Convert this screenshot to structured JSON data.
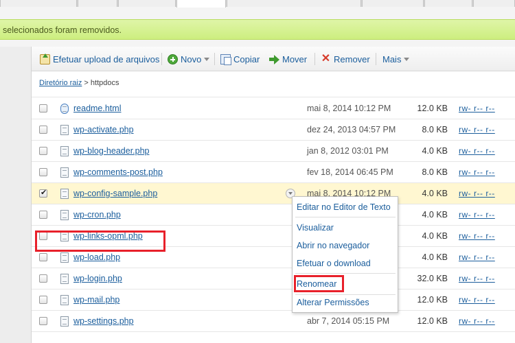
{
  "notice": {
    "text": "selecionados foram removidos."
  },
  "toolbar": {
    "upload_label": "Efetuar upload de arquivos",
    "new_label": "Novo",
    "copy_label": "Copiar",
    "move_label": "Mover",
    "remove_label": "Remover",
    "more_label": "Mais"
  },
  "breadcrumb": {
    "root": "Diretório raiz",
    "sep": ">",
    "current": "httpdocs"
  },
  "files": [
    {
      "name": "readme.html",
      "date": "mai 8, 2014 10:12 PM",
      "size": "12.0 KB",
      "perm": "rw- r-- r--",
      "type": "html",
      "checked": false
    },
    {
      "name": "wp-activate.php",
      "date": "dez 24, 2013 04:57 PM",
      "size": "8.0 KB",
      "perm": "rw- r-- r--",
      "type": "php",
      "checked": false
    },
    {
      "name": "wp-blog-header.php",
      "date": "jan 8, 2012 03:01 PM",
      "size": "4.0 KB",
      "perm": "rw- r-- r--",
      "type": "php",
      "checked": false
    },
    {
      "name": "wp-comments-post.php",
      "date": "fev 18, 2014 06:45 PM",
      "size": "8.0 KB",
      "perm": "rw- r-- r--",
      "type": "php",
      "checked": false
    },
    {
      "name": "wp-config-sample.php",
      "date": "mai 8, 2014 10:12 PM",
      "size": "4.0 KB",
      "perm": "rw- r-- r--",
      "type": "php",
      "checked": true
    },
    {
      "name": "wp-cron.php",
      "date": "",
      "size": "4.0 KB",
      "perm": "rw- r-- r--",
      "type": "php",
      "checked": false
    },
    {
      "name": "wp-links-opml.php",
      "date": "",
      "size": "4.0 KB",
      "perm": "rw- r-- r--",
      "type": "php",
      "checked": false
    },
    {
      "name": "wp-load.php",
      "date": "",
      "size": "4.0 KB",
      "perm": "rw- r-- r--",
      "type": "php",
      "checked": false
    },
    {
      "name": "wp-login.php",
      "date": "",
      "size": "32.0 KB",
      "perm": "rw- r-- r--",
      "type": "php",
      "checked": false
    },
    {
      "name": "wp-mail.php",
      "date": "",
      "size": "12.0 KB",
      "perm": "rw- r-- r--",
      "type": "php",
      "checked": false
    },
    {
      "name": "wp-settings.php",
      "date": "abr 7, 2014 05:15 PM",
      "size": "12.0 KB",
      "perm": "rw- r-- r--",
      "type": "php",
      "checked": false
    }
  ],
  "context_menu": {
    "edit": "Editar no Editor de Texto",
    "view": "Visualizar",
    "open_browser": "Abrir no navegador",
    "download": "Efetuar o download",
    "rename": "Renomear",
    "permissions": "Alterar Permissões"
  },
  "colors": {
    "highlight": "#e8202a",
    "link": "#1a5d9c",
    "notice_bg": "#d6f191",
    "selected_row": "#fff7d1"
  }
}
